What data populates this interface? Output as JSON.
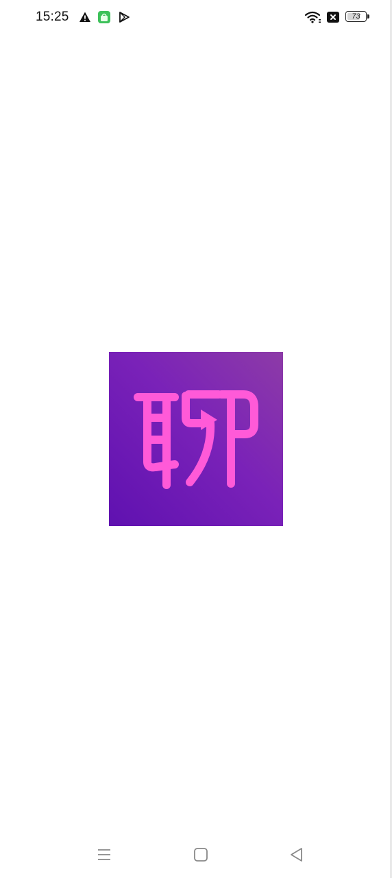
{
  "status_bar": {
    "time": "15:25",
    "icons": [
      "warning-icon",
      "app-notification-icon",
      "play-store-icon",
      "wifi-icon",
      "no-sim-icon"
    ],
    "battery_level": "73",
    "battery_fraction": 0.73
  },
  "splash": {
    "logo_icon": "app-logo-icon",
    "logo_glyph": "聊",
    "colors": {
      "background_start": "#5f11b0",
      "background_end": "#8d3ba7",
      "glyph": "#ff5ad8"
    }
  },
  "nav_bar": {
    "buttons": [
      "menu-icon",
      "home-icon",
      "back-icon"
    ]
  }
}
